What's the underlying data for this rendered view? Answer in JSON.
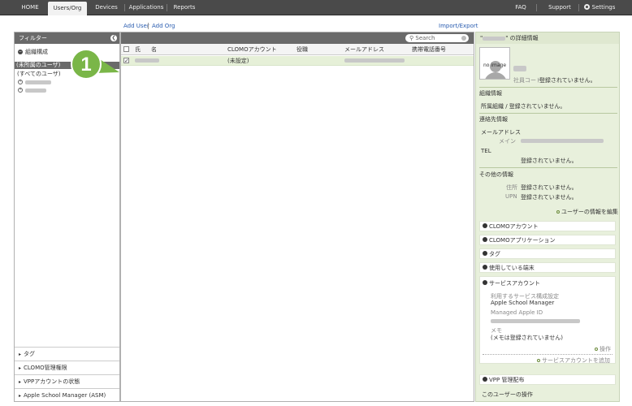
{
  "nav": {
    "home": "HOME",
    "users_org": "Users/Org",
    "devices": "Devices",
    "applications": "Applications",
    "reports": "Reports",
    "faq": "FAQ",
    "support": "Support",
    "settings": "Settings"
  },
  "links": {
    "add_user": "Add User",
    "add_org": "Add Org",
    "import_export": "Import/Export"
  },
  "left_panel": {
    "title": "フィルター",
    "org_structure": "組織構成",
    "unassigned": "(未所属のユーザ)",
    "all_users": "(すべてのユーザ)",
    "footer_items": [
      "タグ",
      "CLOMO管理権限",
      "VPPアカウントの状態",
      "Apple School Manager (ASM)"
    ]
  },
  "table": {
    "search_placeholder": "Search",
    "columns": [
      "氏",
      "名",
      "CLOMOアカウント",
      "役職",
      "メールアドレス",
      "携帯電話番号"
    ],
    "row_clomo_account": "(未設定)"
  },
  "callout_number": "1",
  "details": {
    "header_suffix": "\" の詳細情報",
    "header_prefix": "\"",
    "no_image": "no image",
    "employee_code_label": "社員コード",
    "not_registered": "登録されていません。",
    "org_info": "組織情報",
    "org_label": "所属組織 / 登録されていません。",
    "contact_info": "連絡先情報",
    "email_address": "メールアドレス",
    "main_label": "メイン",
    "tel": "TEL",
    "tel_value": "登録されていません。",
    "other_info": "その他の情報",
    "address_label": "住所",
    "address_value": "登録されていません。",
    "upn_label": "UPN",
    "upn_value": "登録されていません。",
    "edit_user": "ユーザーの情報を編集",
    "accordions": [
      "CLOMOアカウント",
      "CLOMOアプリケーション",
      "タグ",
      "使用している端末"
    ],
    "service_account": "サービスアカウント",
    "service_config_label": "利用するサービス構成設定",
    "service_config_value": "Apple School Manager",
    "managed_apple_id": "Managed Apple ID",
    "memo_label": "メモ",
    "memo_value": "(メモは登録されていません)",
    "operation": "操作",
    "add_service_account": "サービスアカウントを追加",
    "vpp_distribution": "VPP 管理配布",
    "user_operation": "このユーザーの操作"
  }
}
